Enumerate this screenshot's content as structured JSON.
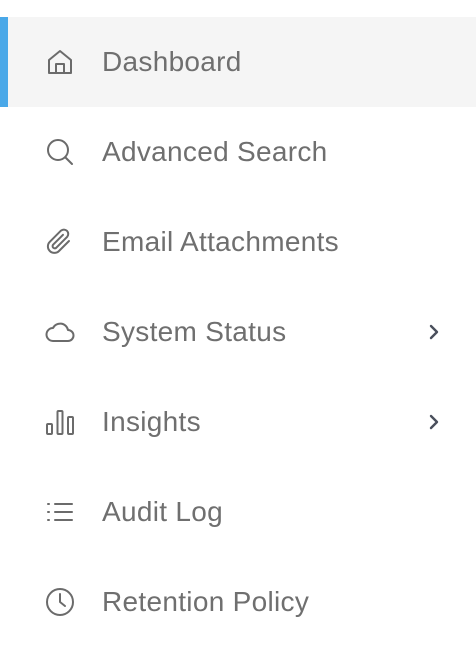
{
  "sidebar": {
    "accent_color": "#4aa8e8",
    "active_index": 0,
    "items": [
      {
        "label": "Dashboard",
        "icon": "home-icon",
        "has_submenu": false,
        "active": true
      },
      {
        "label": "Advanced Search",
        "icon": "search-icon",
        "has_submenu": false,
        "active": false
      },
      {
        "label": "Email Attachments",
        "icon": "paperclip-icon",
        "has_submenu": false,
        "active": false
      },
      {
        "label": "System Status",
        "icon": "cloud-icon",
        "has_submenu": true,
        "active": false
      },
      {
        "label": "Insights",
        "icon": "bar-chart-icon",
        "has_submenu": true,
        "active": false
      },
      {
        "label": "Audit Log",
        "icon": "list-icon",
        "has_submenu": false,
        "active": false
      },
      {
        "label": "Retention Policy",
        "icon": "clock-icon",
        "has_submenu": false,
        "active": false
      }
    ]
  }
}
